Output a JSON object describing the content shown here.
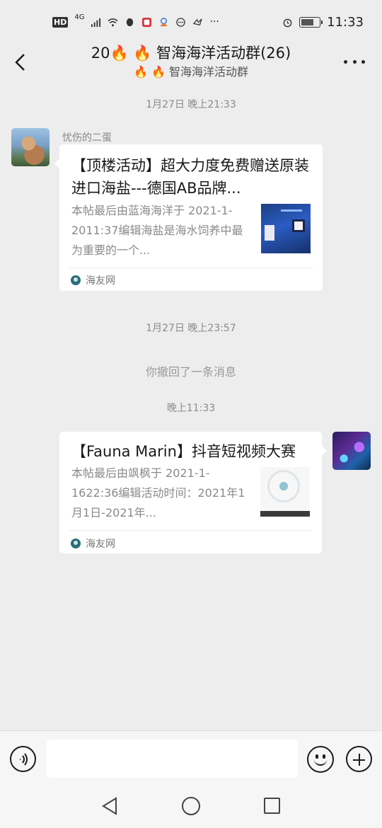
{
  "status_bar": {
    "hd": "HD",
    "signal": "4G",
    "time": "11:33"
  },
  "header": {
    "title": "20🔥 🔥 智海海洋活动群(26)",
    "subtitle": "🔥 🔥 智海海洋活动群"
  },
  "messages": {
    "time1": "1月27日 晚上21:33",
    "sender1": "忧伤的二蛋",
    "card1": {
      "title": "【顶楼活动】超大力度免费赠送原装进口海盐---德国AB品牌...",
      "desc": "本帖最后由蓝海海洋于 2021-1-2011:37编辑海盐是海水饲养中最为重要的一个...",
      "source": "海友网"
    },
    "time2": "1月27日 晚上23:57",
    "recalled": "你撤回了一条消息",
    "time3": "晚上11:33",
    "card2": {
      "title": "【Fauna Marin】抖音短视频大赛",
      "desc": "本帖最后由飒枫于 2021-1-1622:36编辑活动时间：2021年1月1日-2021年...",
      "source": "海友网"
    }
  },
  "input": {
    "value": ""
  }
}
